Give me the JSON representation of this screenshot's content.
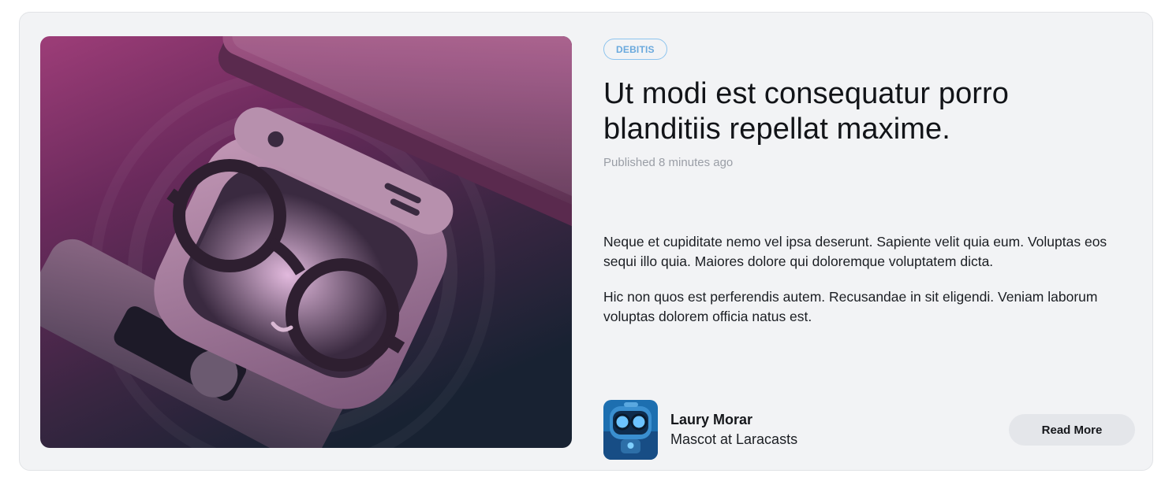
{
  "card": {
    "tag": "DEBITIS",
    "title": "Ut modi est consequatur porro blanditiis repellat maxime.",
    "published": "Published 8 minutes ago",
    "paragraphs": [
      "Neque et cupiditate nemo vel ipsa deserunt. Sapiente velit quia eum. Voluptas eos sequi illo quia. Maiores dolore qui doloremque voluptatem dicta.",
      "Hic non quos est perferendis autem. Recusandae in sit eligendi. Veniam laborum voluptas dolorem officia natus est."
    ],
    "author": {
      "name": "Laury Morar",
      "role": "Mascot at Laracasts"
    },
    "read_more_label": "Read More",
    "hero_icon": "mascot-illustration",
    "colors": {
      "tag_border": "#8dc4ee",
      "tag_text": "#6aa9dd",
      "card_background": "#f2f3f5",
      "button_background": "#e4e6ea"
    }
  }
}
